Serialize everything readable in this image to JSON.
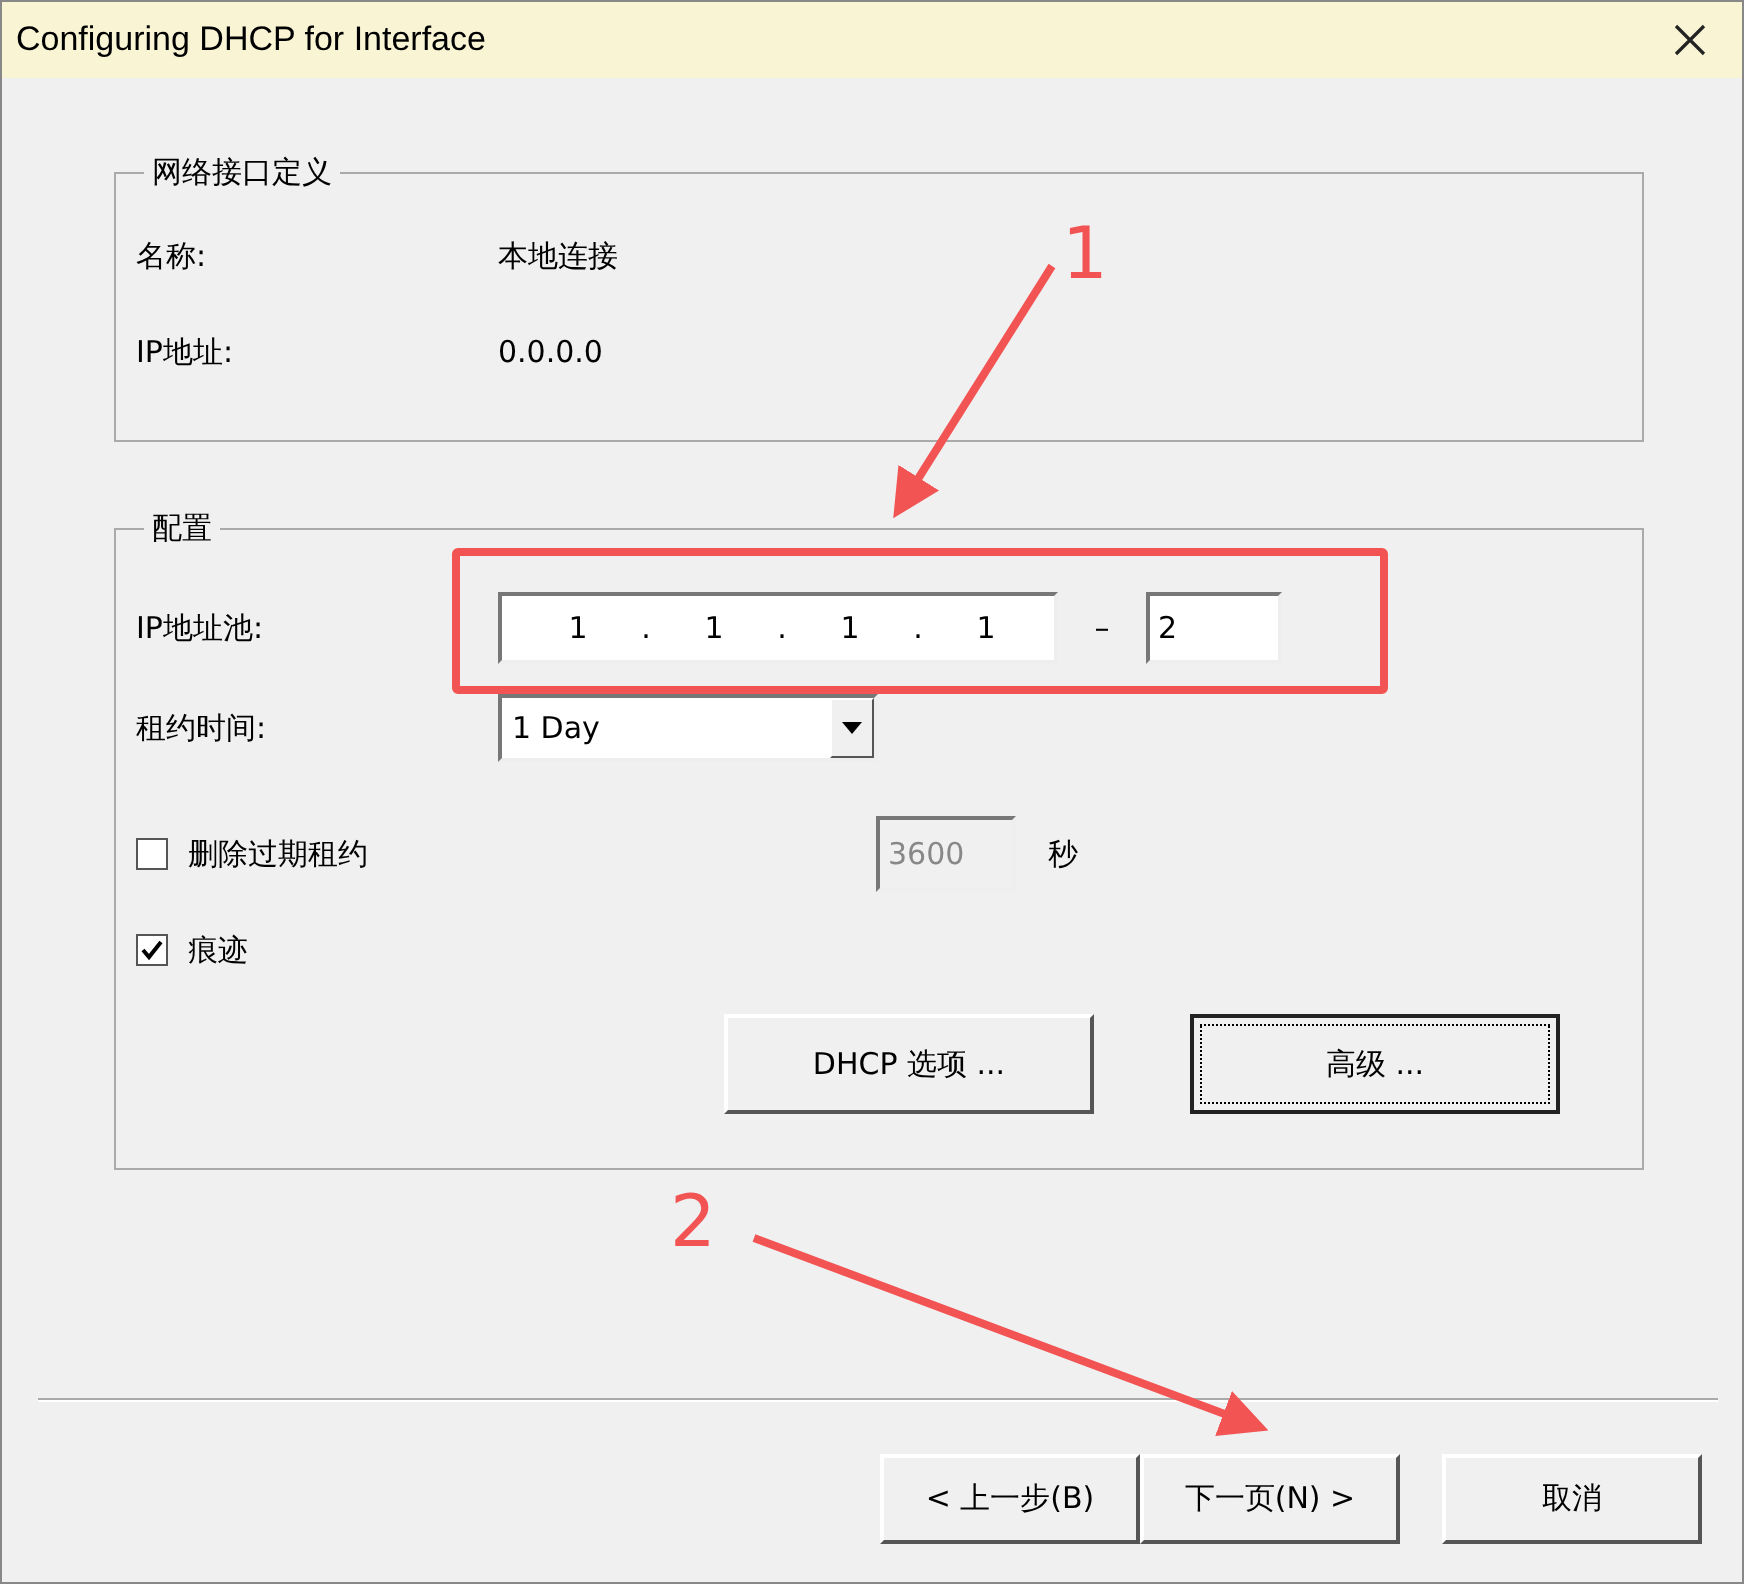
{
  "window": {
    "title": "Configuring DHCP for Interface"
  },
  "interface_group": {
    "title": "网络接口定义",
    "fields": [
      {
        "label": "名称:",
        "value": "本地连接"
      },
      {
        "label": "IP地址:",
        "value": "0.0.0.0"
      }
    ]
  },
  "config_group": {
    "title": "配置",
    "ip_pool": {
      "label": "IP地址池:",
      "octets": [
        "1",
        "1",
        "1",
        "1"
      ],
      "octet_separator": ".",
      "range_separator": "–",
      "end": "2"
    },
    "lease": {
      "label": "租约时间:",
      "value": "1 Day"
    },
    "delete_expired": {
      "label": "删除过期租约",
      "checked": false,
      "seconds": "3600",
      "seconds_disabled": true,
      "unit": "秒"
    },
    "trace": {
      "label": "痕迹",
      "checked": true
    },
    "buttons": [
      {
        "label": "DHCP 选项 ...",
        "focused": false
      },
      {
        "label": "高级 ...",
        "focused": true
      }
    ]
  },
  "footer_buttons": [
    {
      "label": "< 上一步(B)"
    },
    {
      "label": "下一页(N) >"
    },
    {
      "label": "取消"
    }
  ],
  "annotations": [
    {
      "label": "1"
    },
    {
      "label": "2"
    }
  ]
}
